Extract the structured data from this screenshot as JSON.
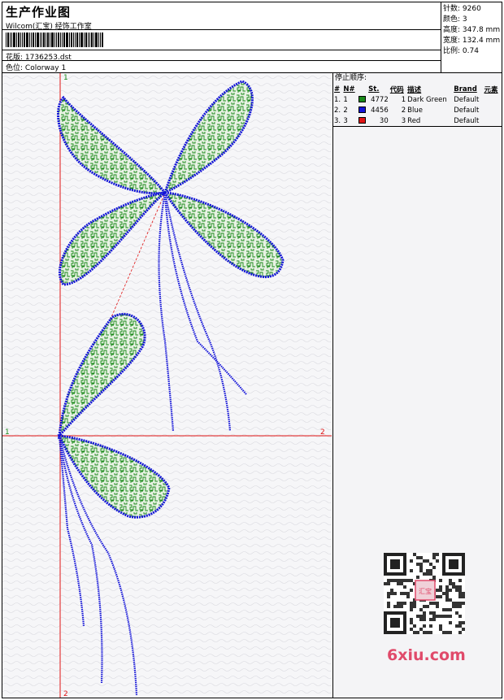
{
  "header": {
    "title": "生产作业图",
    "subtitle": "Wilcom(汇宝) 经饰工作室",
    "pattern_label": "花版:",
    "pattern_value": "1736253.dst",
    "colorway_label": "色位:",
    "colorway_value": "Colorway 1"
  },
  "stats": {
    "stitches_label": "针数:",
    "stitches": "9260",
    "colors_label": "颜色:",
    "colors": "3",
    "height_label": "高度:",
    "height": "347.8 mm",
    "width_label": "宽度:",
    "width": "132.4 mm",
    "scale_label": "比例:",
    "scale": "0.74"
  },
  "stop_sequence": {
    "title": "停止顺序:",
    "headers": [
      "#",
      "N#",
      "St.",
      "代码",
      "描述",
      "Brand",
      "元素"
    ],
    "rows": [
      {
        "index": "1.",
        "needle": "1",
        "color": "#1a8a1a",
        "stitches": "4772",
        "code": "1",
        "description": "Dark Green",
        "brand": "Default"
      },
      {
        "index": "2.",
        "needle": "2",
        "color": "#1414d8",
        "stitches": "4456",
        "code": "2",
        "description": "Blue",
        "brand": "Default"
      },
      {
        "index": "3.",
        "needle": "3",
        "color": "#e01414",
        "stitches": "30",
        "code": "3",
        "description": "Red",
        "brand": "Default"
      }
    ]
  },
  "design": {
    "axis_labels": {
      "top": "1",
      "left": "1",
      "right": "2",
      "bottom": "2"
    },
    "thread_colors": {
      "fill": "#1a8a1a",
      "outline": "#1414d8",
      "axis": "#e01414"
    }
  },
  "watermark": {
    "text": "6xiu.com",
    "seal": "汇宝"
  }
}
